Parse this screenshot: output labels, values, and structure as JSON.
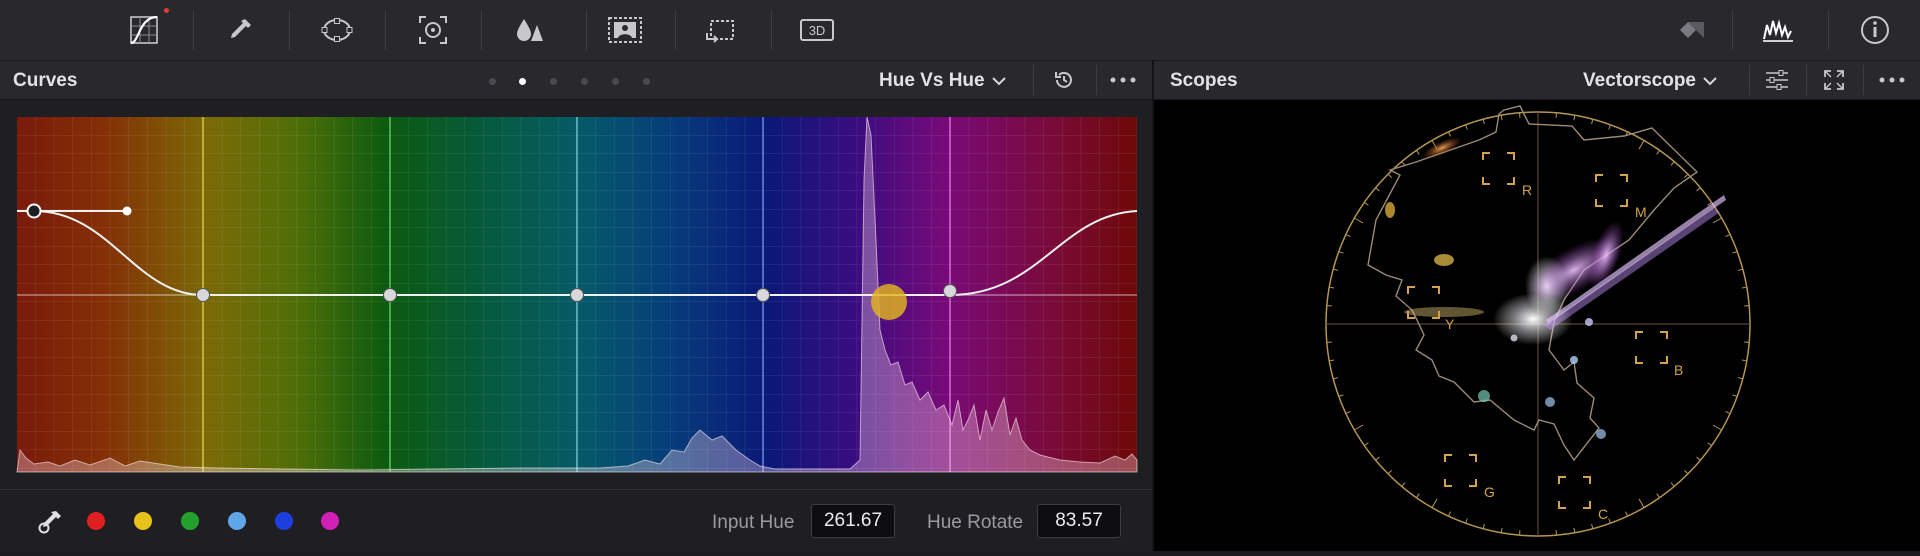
{
  "toolbar": {
    "tools": [
      {
        "icon": "curves-icon"
      },
      {
        "icon": "qualifier-picker-icon"
      },
      {
        "icon": "window-icon"
      },
      {
        "icon": "tracker-icon"
      },
      {
        "icon": "blur-icon"
      },
      {
        "icon": "key-icon"
      },
      {
        "icon": "sizing-icon"
      },
      {
        "icon": "3d-icon",
        "label": "3D"
      }
    ],
    "right_tools": [
      {
        "icon": "keyframes-icon"
      },
      {
        "icon": "scopes-icon"
      },
      {
        "icon": "info-icon"
      }
    ]
  },
  "curves": {
    "title": "Curves",
    "mode": "Hue Vs Hue",
    "page_count": 6,
    "active_page": 2,
    "input_hue_label": "Input Hue",
    "input_hue_value": "261.67",
    "hue_rotate_label": "Hue Rotate",
    "hue_rotate_value": "83.57",
    "swatches": [
      {
        "name": "red",
        "color": "#e02020"
      },
      {
        "name": "yellow",
        "color": "#e6c21a"
      },
      {
        "name": "green",
        "color": "#23a12c"
      },
      {
        "name": "cyan",
        "color": "#5fa6e8"
      },
      {
        "name": "blue",
        "color": "#1e3fe0"
      },
      {
        "name": "magenta",
        "color": "#d11fb8"
      }
    ]
  },
  "scopes": {
    "title": "Scopes",
    "mode": "Vectorscope",
    "targets": [
      "R",
      "M",
      "Y",
      "B",
      "G",
      "C"
    ]
  },
  "colors": {
    "accent": "#e3b41f",
    "panel": "#28282d",
    "graticule": "#b59552"
  }
}
